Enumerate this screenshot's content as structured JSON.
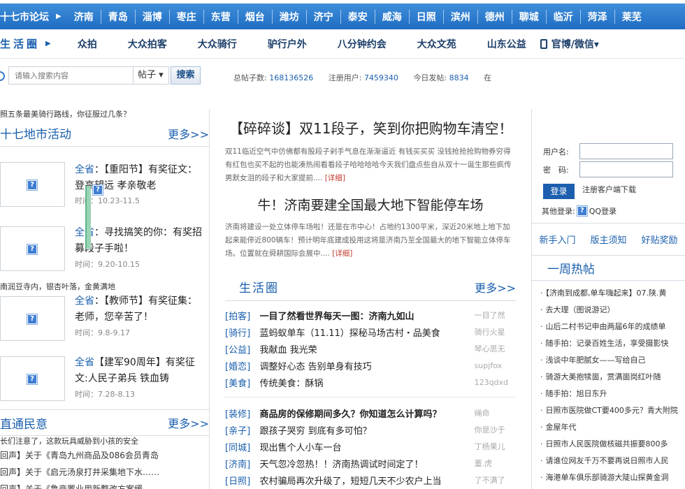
{
  "citybar": {
    "forum": "十七市论坛",
    "cities": [
      "济南",
      "青岛",
      "淄博",
      "枣庄",
      "东营",
      "烟台",
      "潍坊",
      "济宁",
      "泰安",
      "威海",
      "日照",
      "滨州",
      "德州",
      "聊城",
      "临沂",
      "菏泽",
      "莱芜"
    ]
  },
  "subnav": {
    "life": "生活圈",
    "items": [
      "众拍",
      "大众拍客",
      "大众骑行",
      "驴行户外",
      "八分钟约会",
      "大众文苑",
      "山东公益"
    ],
    "weibo": "官博/微信▾"
  },
  "search": {
    "placeholder": "请输入搜索内容",
    "type": "帖子 ▾",
    "button": "搜索",
    "stats": {
      "total_label": "总帖子数:",
      "total": "168136526",
      "users_label": "注册用户:",
      "users": "7459340",
      "today_label": "今日发帖:",
      "today": "8834",
      "online_label": "在"
    }
  },
  "left": {
    "top_note": "照五条最美骑行路线，你征服过几条？",
    "events_title": "十七地市活动",
    "more": "更多>>",
    "events": [
      {
        "scope": "全省",
        "title": "：【重阳节】有奖征文：登高望远 孝亲敬老",
        "time": "时间：10.23-11.5"
      },
      {
        "scope": "全省",
        "title": "：寻找搞笑的你：有奖招募段子手啦！",
        "time": "时间：9.20-10.15"
      },
      {
        "scope": "全省",
        "title": "：【教师节】有奖征集：老师，您辛苦了！",
        "time": "时间：9.8-9.17"
      },
      {
        "scope": "全省",
        "title": "【建军90周年】有奖征文:人民子弟兵 铁血铸",
        "time": "时间：7.28-8.13"
      }
    ],
    "mid_note": "南润豆寺内，银杏叶落，金黄满地",
    "minyi_title": "直通民意",
    "minyi_note": "长们注意了，这款玩具威胁到小孩的安全",
    "minyi": [
      "回声】关于《青岛九州商品及086会员青岛",
      "回声】关于《启元汤泉打井采集地下水……",
      "回声】关于《鲁商置业用新整改方案缓……"
    ]
  },
  "center": {
    "headline": "【碎碎谈】双11段子，笑到你把购物车清空！",
    "summary": "双11临近空气中仿佛都有股段子剁手气息在渐渐逼近 有钱买买买 没钱抢抢抢购物券穷得有红包也买不起的也能凑热闹看看段子哈哈哈哈今天我们盘点些自从双十一诞生那些疯传男默女泪的段子和大家提前....",
    "detail": "[详细]",
    "headline2": "牛！济南要建全国最大地下智能停车场",
    "summary2": "济南将建设一处立体停车场啦！还是在市中心！占地约1300平米，深近20米地上地下加起来能停近800辆车！预计明年底建成投用这将是济南乃至全国最大的地下智能立体停车场。位置就在舜耕国际会展中....",
    "detail2": "[详细]",
    "life_title": "生活圈",
    "more": "更多>>",
    "posts": [
      {
        "cat": "[拍客]",
        "title": "一目了然看世界每天一图：济南九如山",
        "author": "一目了然",
        "bold": true
      },
      {
        "cat": "[骑行]",
        "title": "蓝蚂蚁单车（11.11）探秘马场古村・品美食",
        "author": "骑行火星",
        "bold": false
      },
      {
        "cat": "[公益]",
        "title": "我献血 我光荣",
        "author": "琴心思无",
        "bold": false
      },
      {
        "cat": "[婚恋]",
        "title": "调整好心态 告别单身有技巧",
        "author": "supjfox",
        "bold": false
      },
      {
        "cat": "[美食]",
        "title": "传统美食：酥锅",
        "author": "123qdxd",
        "bold": false
      }
    ],
    "posts2": [
      {
        "cat": "[装修]",
        "title": "商品房的保修期间多久？你知道怎么计算吗？",
        "author": "绳命",
        "bold": true
      },
      {
        "cat": "[亲子]",
        "title": "跟孩子哭穷 到底有多可怕？",
        "author": "你是沙于",
        "bold": false
      },
      {
        "cat": "[同城]",
        "title": "现出售个人小车一台",
        "author": "丁杨果儿",
        "bold": false
      },
      {
        "cat": "[济南]",
        "title": "天气忽冷忽热！！济南热调试时间定了！",
        "author": "董.虎",
        "bold": false
      },
      {
        "cat": "[日照]",
        "title": "农村骗局再次升级了，短短几天不少农户上当",
        "author": "了不满了",
        "bold": false
      }
    ]
  },
  "right": {
    "username_label": "用户名:",
    "password_label": "密　码:",
    "login": "登录",
    "register": "注册客户端下载",
    "other_login": "其他登录:",
    "qq": "QQ登录",
    "links": [
      "新手入门",
      "版主须知",
      "好贴奖励"
    ],
    "hot_title": "一周热帖",
    "hot": [
      "【济南到成都,单车嗨起来】07.陕.黄",
      "去大理（图说游记）",
      "山后二村书记申由两届6年的成绩单",
      "随手拍：记录百姓生活，享受摄影快",
      "浅谈中年肥腻女——写给自己",
      "骑游大美抱犊崮，赏满崮岗红叶随",
      "随手拍：旭日东升",
      "日照市医院做CT要400多元？青大附院",
      "金屋年代",
      "日照市人民医院做核磁共振要800多",
      "请谁位网友千万不要再说日照市人民",
      "海港单车俱乐部骑游大陡山探黄金洞"
    ]
  }
}
